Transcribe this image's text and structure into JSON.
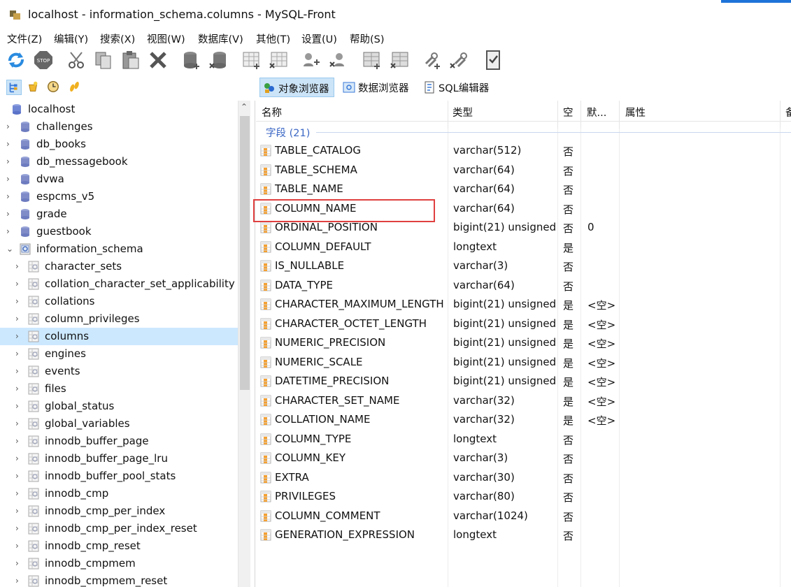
{
  "window": {
    "title": "localhost - information_schema.columns - MySQL-Front",
    "accent_color": "#1e73d8"
  },
  "menu": [
    "文件(Z)",
    "编辑(Y)",
    "搜索(X)",
    "视图(W)",
    "数据库(V)",
    "其他(T)",
    "设置(U)",
    "帮助(S)"
  ],
  "toolbar": {
    "icons": [
      "refresh-icon",
      "stop-icon",
      "cut-icon",
      "copy-icon",
      "paste-icon",
      "delete-icon",
      "new-database-icon",
      "delete-database-icon",
      "new-table-icon",
      "delete-table-icon",
      "new-user-icon",
      "delete-user-icon",
      "new-link-icon",
      "delete-link-icon",
      "checklist-icon"
    ]
  },
  "nav_toolbar": {
    "icons": [
      "object-tree-icon",
      "favorites-icon",
      "history-icon",
      "footprints-icon"
    ],
    "tabs": [
      {
        "label": "对象浏览器",
        "icon": "object-browser-icon",
        "active": true
      },
      {
        "label": "数据浏览器",
        "icon": "data-browser-icon",
        "active": false
      },
      {
        "label": "SQL编辑器",
        "icon": "sql-editor-icon",
        "active": false
      }
    ]
  },
  "tree": {
    "root": "localhost",
    "databases": [
      "challenges",
      "db_books",
      "db_messagebook",
      "dvwa",
      "espcms_v5",
      "grade",
      "guestbook"
    ],
    "expanded_db": "information_schema",
    "tables": [
      "character_sets",
      "collation_character_set_applicability",
      "collations",
      "column_privileges",
      "columns",
      "engines",
      "events",
      "files",
      "global_status",
      "global_variables",
      "innodb_buffer_page",
      "innodb_buffer_page_lru",
      "innodb_buffer_pool_stats",
      "innodb_cmp",
      "innodb_cmp_per_index",
      "innodb_cmp_per_index_reset",
      "innodb_cmp_reset",
      "innodb_cmpmem",
      "innodb_cmpmem_reset"
    ],
    "selected": "columns"
  },
  "grid": {
    "headers": [
      "名称",
      "类型",
      "空",
      "默...",
      "属性",
      "备"
    ],
    "group_label": "字段 (21)",
    "highlighted_field": "COLUMN_NAME",
    "rows": [
      [
        "TABLE_CATALOG",
        "varchar(512)",
        "否",
        ""
      ],
      [
        "TABLE_SCHEMA",
        "varchar(64)",
        "否",
        ""
      ],
      [
        "TABLE_NAME",
        "varchar(64)",
        "否",
        ""
      ],
      [
        "COLUMN_NAME",
        "varchar(64)",
        "否",
        ""
      ],
      [
        "ORDINAL_POSITION",
        "bigint(21) unsigned",
        "否",
        "0"
      ],
      [
        "COLUMN_DEFAULT",
        "longtext",
        "是",
        ""
      ],
      [
        "IS_NULLABLE",
        "varchar(3)",
        "否",
        ""
      ],
      [
        "DATA_TYPE",
        "varchar(64)",
        "否",
        ""
      ],
      [
        "CHARACTER_MAXIMUM_LENGTH",
        "bigint(21) unsigned",
        "是",
        "<空>"
      ],
      [
        "CHARACTER_OCTET_LENGTH",
        "bigint(21) unsigned",
        "是",
        "<空>"
      ],
      [
        "NUMERIC_PRECISION",
        "bigint(21) unsigned",
        "是",
        "<空>"
      ],
      [
        "NUMERIC_SCALE",
        "bigint(21) unsigned",
        "是",
        "<空>"
      ],
      [
        "DATETIME_PRECISION",
        "bigint(21) unsigned",
        "是",
        "<空>"
      ],
      [
        "CHARACTER_SET_NAME",
        "varchar(32)",
        "是",
        "<空>"
      ],
      [
        "COLLATION_NAME",
        "varchar(32)",
        "是",
        "<空>"
      ],
      [
        "COLUMN_TYPE",
        "longtext",
        "否",
        ""
      ],
      [
        "COLUMN_KEY",
        "varchar(3)",
        "否",
        ""
      ],
      [
        "EXTRA",
        "varchar(30)",
        "否",
        ""
      ],
      [
        "PRIVILEGES",
        "varchar(80)",
        "否",
        ""
      ],
      [
        "COLUMN_COMMENT",
        "varchar(1024)",
        "否",
        ""
      ],
      [
        "GENERATION_EXPRESSION",
        "longtext",
        "否",
        ""
      ]
    ]
  }
}
